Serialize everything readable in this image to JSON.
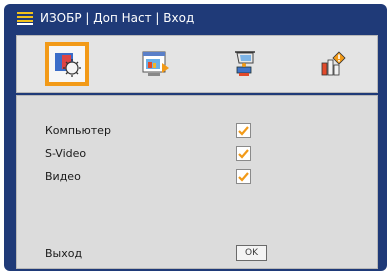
{
  "title": {
    "text": "ИЗОБР | Доп Наст | Вход",
    "icon": "menu-icon"
  },
  "tabs": [
    {
      "name": "image-settings-icon",
      "selected": true
    },
    {
      "name": "display-setup-icon",
      "selected": false
    },
    {
      "name": "installation-icon",
      "selected": false
    },
    {
      "name": "info-icon",
      "selected": false
    }
  ],
  "inputs": [
    {
      "label": "Компьютер",
      "checked": true
    },
    {
      "label": "S-Video",
      "checked": true
    },
    {
      "label": "Видео",
      "checked": true
    }
  ],
  "exit": {
    "label": "Выход",
    "button_label": "OK"
  },
  "colors": {
    "frame": "#1f3a78",
    "selected_tab": "#f29a18",
    "check": "#f29a18",
    "panel": "#dcdcdc"
  }
}
